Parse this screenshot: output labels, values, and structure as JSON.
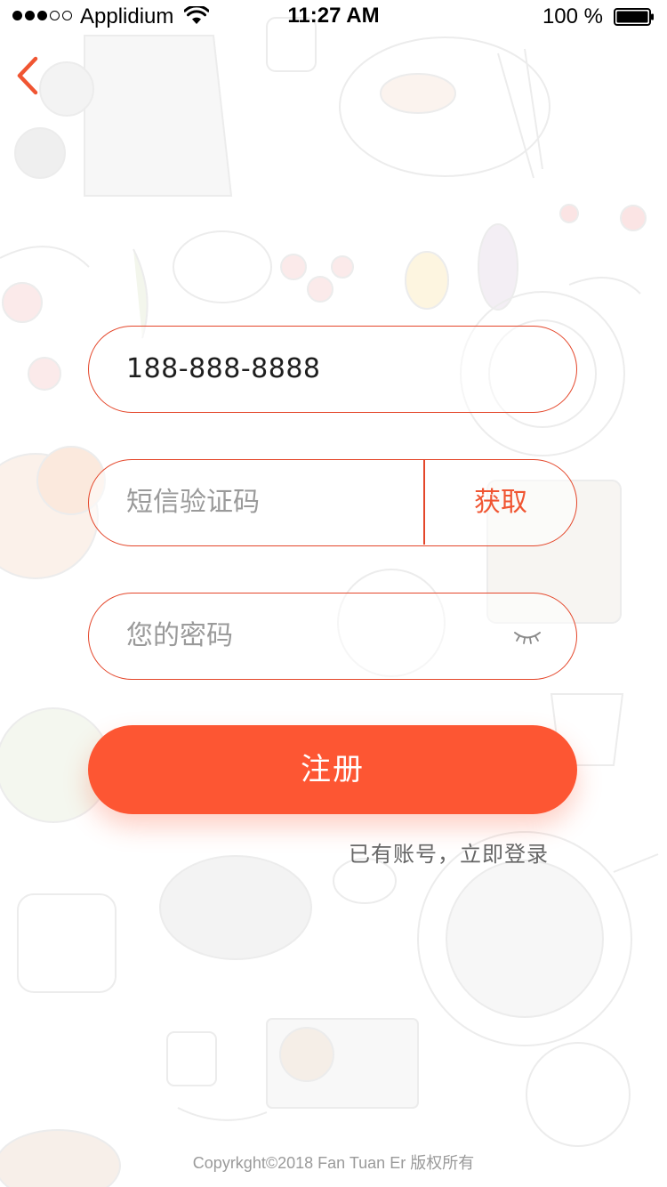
{
  "status_bar": {
    "carrier": "Applidium",
    "time": "11:27 AM",
    "battery": "100 %",
    "signal_bars_filled": 3,
    "signal_bars_total": 5
  },
  "nav": {
    "back_icon": "chevron-left-icon"
  },
  "form": {
    "phone_value": "188-888-8888",
    "code_placeholder": "短信验证码",
    "get_code_label": "获取",
    "password_placeholder": "您的密码",
    "eye_icon": "eye-closed-icon"
  },
  "register_label": "注册",
  "login_link": "已有账号，立即登录",
  "copyright": "Copyrkght©2018 Fan Tuan Er 版权所有",
  "colors": {
    "accent": "#fd5633",
    "border": "#e4462a",
    "placeholder": "#9a9a9a"
  }
}
